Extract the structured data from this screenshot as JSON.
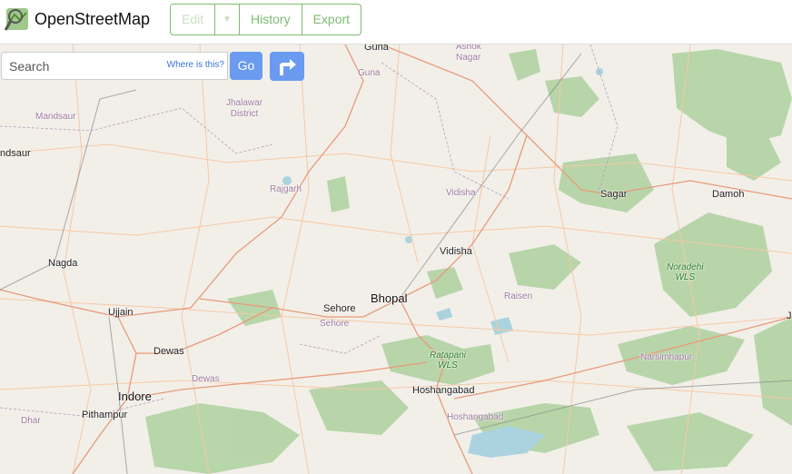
{
  "header": {
    "brand": "OpenStreetMap",
    "edit_label": "Edit",
    "history_label": "History",
    "export_label": "Export"
  },
  "search": {
    "placeholder": "Search",
    "where_label": "Where is this?",
    "go_label": "Go"
  },
  "colors": {
    "accent_green": "#7ebc6f",
    "button_blue": "#6a9bf0",
    "map_bg": "#f2efe9",
    "forest": "#add19e",
    "water": "#aad3df"
  },
  "map": {
    "labels": {
      "guna": "Guna",
      "guna_dist": "Guna",
      "ashok_nagar": "Ashok\nNagar",
      "mandsaur_dist": "Mandsaur",
      "jhalawar": "Jhalawar\nDistrict",
      "mandsaur": "ndsaur",
      "rajgarh": "Rajgarh",
      "vidisha_dist": "Vidisha",
      "sagar": "Sagar",
      "damoh": "Damoh",
      "vidisha": "Vidisha",
      "noradehi": "Noradehi\nWLS",
      "nagda": "Nagda",
      "bhopal": "Bhopal",
      "raisen": "Raisen",
      "ujjain": "Ujjain",
      "sehore": "Sehore",
      "sehore_dist": "Sehore",
      "dewas": "Dewas",
      "ratapani": "Ratapani\nWLS",
      "narsimhapur": "Narsimhapur",
      "dewas_dist": "Dewas",
      "hoshangabad": "Hoshangabad",
      "indore": "Indore",
      "hoshangabad_dist": "Hoshangabad",
      "pithampur": "Pithampur",
      "dhar": "Dhar",
      "edge_j": "J"
    }
  }
}
